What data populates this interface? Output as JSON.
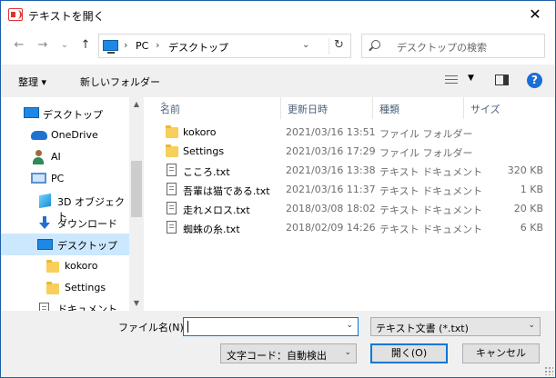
{
  "window": {
    "title": "テキストを開く",
    "close_glyph": "✕"
  },
  "nav": {
    "back_glyph": "←",
    "forward_glyph": "→",
    "recent_glyph": "⌄",
    "up_glyph": "↑",
    "breadcrumb": [
      "PC",
      "デスクトップ"
    ],
    "crumb_sep": "›",
    "dropdown_glyph": "⌄",
    "refresh_glyph": "↻",
    "search_placeholder": "デスクトップの検索"
  },
  "toolbar": {
    "organize": "整理 ▾",
    "new_folder": "新しいフォルダー",
    "view_dd": "▼",
    "help": "?"
  },
  "sidebar": {
    "items": [
      {
        "label": "デスクトップ",
        "icon": "desktop-icon"
      },
      {
        "label": "OneDrive",
        "icon": "cloud-icon"
      },
      {
        "label": "AI",
        "icon": "user-icon"
      },
      {
        "label": "PC",
        "icon": "pc-icon"
      },
      {
        "label": "3D オブジェクト",
        "icon": "cube-icon"
      },
      {
        "label": "ダウンロード",
        "icon": "download-icon"
      },
      {
        "label": "デスクトップ",
        "icon": "desktop-icon",
        "selected": true
      },
      {
        "label": "kokoro",
        "icon": "folder-icon"
      },
      {
        "label": "Settings",
        "icon": "folder-icon"
      },
      {
        "label": "ドキュメント",
        "icon": "documents-icon"
      }
    ],
    "scroll_up": "▲",
    "scroll_down": "▼"
  },
  "filelist": {
    "columns": {
      "name": "名前",
      "date": "更新日時",
      "type": "種類",
      "size": "サイズ"
    },
    "sort_glyph": "^",
    "rows": [
      {
        "name": "kokoro",
        "date": "2021/03/16 13:51",
        "type": "ファイル フォルダー",
        "size": "",
        "icon": "folder-icon"
      },
      {
        "name": "Settings",
        "date": "2021/03/16 17:29",
        "type": "ファイル フォルダー",
        "size": "",
        "icon": "folder-icon"
      },
      {
        "name": "こころ.txt",
        "date": "2021/03/16 13:38",
        "type": "テキスト ドキュメント",
        "size": "320 KB",
        "icon": "text-file-icon"
      },
      {
        "name": "吾輩は猫である.txt",
        "date": "2021/03/16 11:37",
        "type": "テキスト ドキュメント",
        "size": "1 KB",
        "icon": "text-file-icon"
      },
      {
        "name": "走れメロス.txt",
        "date": "2018/03/08 18:02",
        "type": "テキスト ドキュメント",
        "size": "20 KB",
        "icon": "text-file-icon"
      },
      {
        "name": "蜘蛛の糸.txt",
        "date": "2018/02/09 14:26",
        "type": "テキスト ドキュメント",
        "size": "6 KB",
        "icon": "text-file-icon"
      }
    ]
  },
  "bottom": {
    "filename_label": "ファイル名(N):",
    "filename_value": "",
    "filter_value": "テキスト文書 (*.txt)",
    "encoding_value": "文字コード：自動検出",
    "open_label": "開く(O)",
    "cancel_label": "キャンセル",
    "dd_glyph": "⌄"
  }
}
